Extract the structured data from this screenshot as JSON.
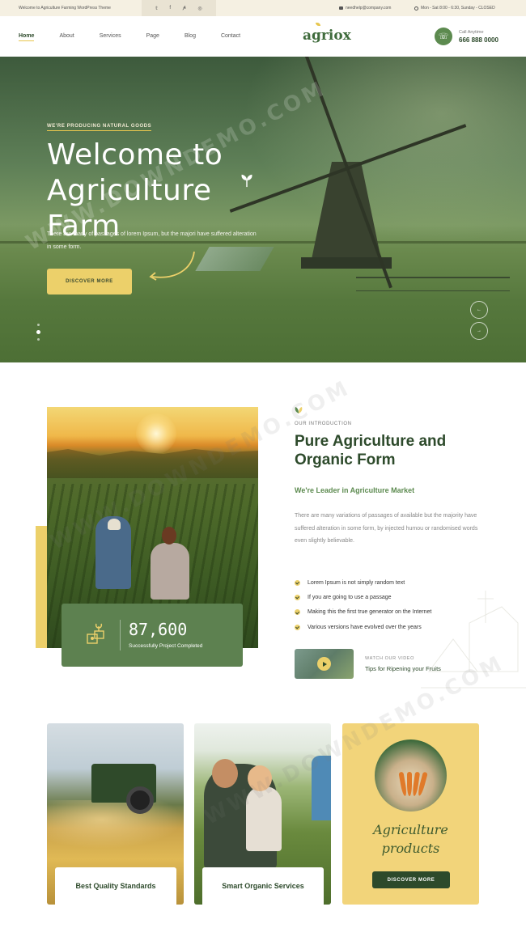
{
  "topbar": {
    "welcome": "Welcome to Agriculture Farming WordPress Theme",
    "social_icons": [
      "twitter-icon",
      "facebook-icon",
      "pinterest-icon",
      "instagram-icon"
    ],
    "email": "needhelp@company.com",
    "hours": "Mon - Sat 8:00 - 6:30, Sunday - CLOSED"
  },
  "nav": {
    "items": [
      "Home",
      "About",
      "Services",
      "Page",
      "Blog",
      "Contact"
    ],
    "active": "Home"
  },
  "logo": {
    "text": "agriox"
  },
  "call": {
    "label": "Call Anytime",
    "number": "666 888 0000"
  },
  "hero": {
    "tagline": "WE'RE PRODUCING NATURAL GOODS",
    "title_line1": "Welcome to",
    "title_line2": "Agriculture Farm",
    "description": "There are many of passages of lorem Ipsum, but the majori have suffered alteration in some form.",
    "cta": "DISCOVER MORE",
    "prev_label": "←",
    "next_label": "→"
  },
  "intro": {
    "tag": "OUR INTRODUCTION",
    "title": "Pure Agriculture and Organic Form",
    "subtitle": "We're Leader in Agriculture Market",
    "description": "There are many variations of passages of available but the majority have suffered alteration in some form, by injected humou or randomised words even slightly believable.",
    "checklist": [
      "Lorem Ipsum is not simply random text",
      "If you are going to use a passage",
      "Making this the first true generator on the Internet",
      "Various versions have evolved over the years"
    ],
    "stat_number": "87,600",
    "stat_caption": "Successfully Project Completed",
    "video_label": "WATCH OUR VIDEO",
    "video_title": "Tips for Ripening your Fruits"
  },
  "cards": [
    {
      "label": "Best Quality Standards"
    },
    {
      "label": "Smart Organic Services"
    },
    {
      "title_line1": "Agriculture",
      "title_line2": "products",
      "button": "DISCOVER MORE"
    }
  ],
  "watermark": "WWW.DOWNDEMO.COM",
  "colors": {
    "brand_green": "#2d4a2b",
    "accent_yellow": "#ecd06a",
    "card_green": "#5d8150"
  }
}
